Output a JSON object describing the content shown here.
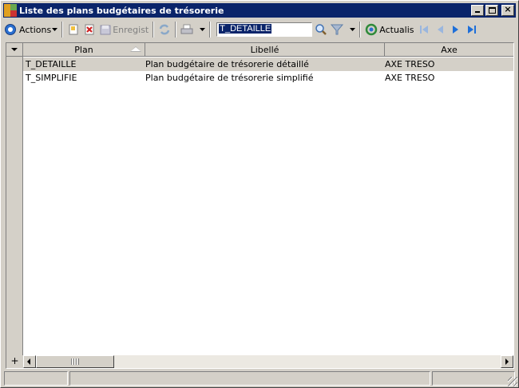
{
  "window": {
    "title": "Liste des plans budgétaires de trésorerie"
  },
  "toolbar": {
    "actions_label": "Actions",
    "save_label": "Enregist",
    "search_value": "T_DETAILLE",
    "refresh_label": "Actualis"
  },
  "grid": {
    "columns": [
      "Plan",
      "Libellé",
      "Axe"
    ],
    "rows": [
      {
        "plan": "T_DETAILLE",
        "libelle": "Plan budgétaire de trésorerie détaillé",
        "axe": "AXE TRESO"
      },
      {
        "plan": "T_SIMPLIFIE",
        "libelle": "Plan budgétaire de trésorerie simplifié",
        "axe": "AXE TRESO"
      }
    ],
    "add_row_symbol": "+"
  },
  "status": {
    "panel1": "",
    "panel2": "",
    "panel3": ""
  },
  "colors": {
    "titlebar": "#0a246a",
    "face": "#d4d0c8",
    "nav_arrow": "#1e6fd9",
    "nav_disabled": "#9ab6de"
  }
}
